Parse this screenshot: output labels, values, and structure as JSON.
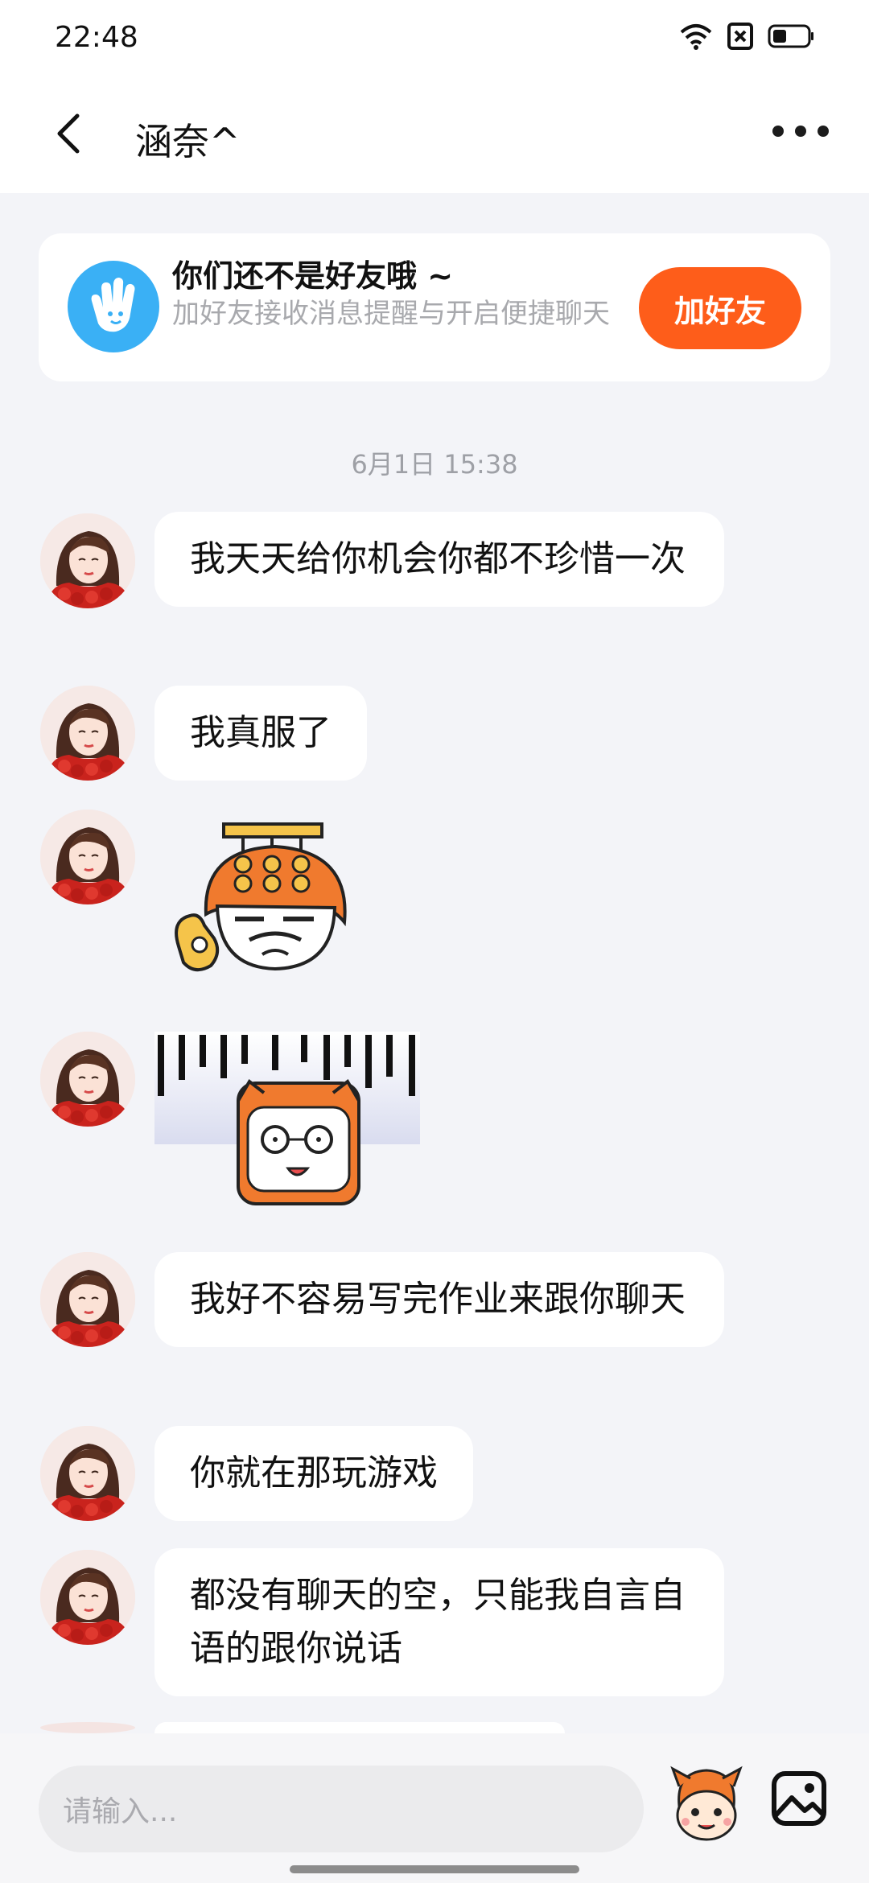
{
  "status_bar": {
    "time": "22:48"
  },
  "header": {
    "title": "涵奈^"
  },
  "friend_banner": {
    "title": "你们还不是好友哦 ~",
    "subtitle": "加好友接收消息提醒与开启便捷聊天",
    "button_label": "加好友"
  },
  "timestamp": "6月1日 15:38",
  "messages": [
    {
      "type": "text",
      "text": "我天天给你机会你都不珍惜一次"
    },
    {
      "type": "text",
      "text": "我真服了"
    },
    {
      "type": "sticker",
      "icon": "mascot-ok-sticker"
    },
    {
      "type": "sticker",
      "icon": "mascot-shocked-sticker"
    },
    {
      "type": "text",
      "text": "我好不容易写完作业来跟你聊天"
    },
    {
      "type": "text",
      "text": "你就在那玩游戏"
    },
    {
      "type": "text",
      "text": "都没有聊天的空，只能我自言自语的跟你说话"
    }
  ],
  "input": {
    "placeholder": "请输入..."
  },
  "colors": {
    "accent": "#fe5d1a",
    "background": "#f3f4f8",
    "banner_icon": "#3ab0f5"
  }
}
